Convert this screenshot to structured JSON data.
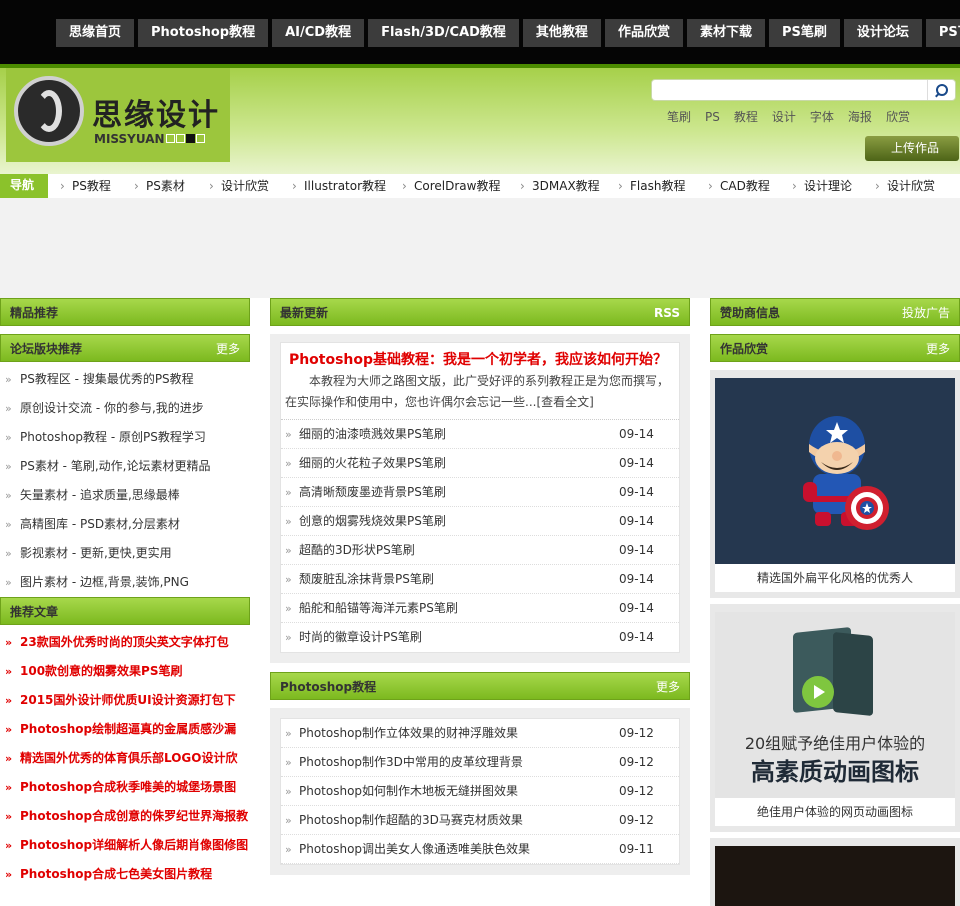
{
  "topnav": [
    "思缘首页",
    "Photoshop教程",
    "AI/CD教程",
    "Flash/3D/CAD教程",
    "其他教程",
    "作品欣赏",
    "素材下载",
    "PS笔刷",
    "设计论坛",
    "PS下载"
  ],
  "logo": {
    "cn": "思缘设计",
    "en": "MISSYUAN"
  },
  "search": {
    "placeholder": "",
    "icon": "search-icon"
  },
  "hotwords": [
    "笔刷",
    "PS",
    "教程",
    "设计",
    "字体",
    "海报",
    "欣赏"
  ],
  "upload_label": "上传作品",
  "catnav": {
    "label": "导航",
    "items": [
      "PS教程",
      "PS素材",
      "设计欣赏",
      "Illustrator教程",
      "CorelDraw教程",
      "3DMAX教程",
      "Flash教程",
      "CAD教程",
      "设计理论",
      "设计欣赏"
    ]
  },
  "left": {
    "recommend_title": "精品推荐",
    "forum_title": "论坛版块推荐",
    "forum_more": "更多",
    "forum_items": [
      "PS教程区 - 搜集最优秀的PS教程",
      "原创设计交流 - 你的参与,我的进步",
      "Photoshop教程 - 原创PS教程学习",
      "PS素材 - 笔刷,动作,论坛素材更精品",
      "矢量素材 - 追求质量,思缘最棒",
      "高精图库 - PSD素材,分层素材",
      "影视素材 - 更新,更快,更实用",
      "图片素材 - 边框,背景,装饰,PNG"
    ],
    "articles_title": "推荐文章",
    "articles": [
      "23款国外优秀时尚的顶尖英文字体打包",
      "100款创意的烟雾效果PS笔刷",
      "2015国外设计师优质UI设计资源打包下",
      "Photoshop绘制超逼真的金属质感沙漏",
      "精选国外优秀的体育俱乐部LOGO设计欣",
      "Photoshop合成秋季唯美的城堡场景图",
      "Photoshop合成创意的侏罗纪世界海报教",
      "Photoshop详细解析人像后期肖像图修图",
      "Photoshop合成七色美女图片教程"
    ]
  },
  "middle": {
    "latest_title": "最新更新",
    "latest_rss": "RSS",
    "featured_title": "Photoshop基础教程：我是一个初学者，我应该如何开始？",
    "featured_desc": "本教程为大师之路图文版，此广受好评的系列教程正是为您而撰写，在实际操作和使用中，您也许偶尔会忘记一些...[查看全文]",
    "latest": [
      {
        "title": "细丽的油漆喷溅效果PS笔刷",
        "date": "09-14"
      },
      {
        "title": "细丽的火花粒子效果PS笔刷",
        "date": "09-14"
      },
      {
        "title": "高清晰颓废墨迹背景PS笔刷",
        "date": "09-14"
      },
      {
        "title": "创意的烟雾残烧效果PS笔刷",
        "date": "09-14"
      },
      {
        "title": "超酷的3D形状PS笔刷",
        "date": "09-14"
      },
      {
        "title": "颓废脏乱涂抹背景PS笔刷",
        "date": "09-14"
      },
      {
        "title": "船舵和船锚等海洋元素PS笔刷",
        "date": "09-14"
      },
      {
        "title": "时尚的徽章设计PS笔刷",
        "date": "09-14"
      }
    ],
    "ps_title": "Photoshop教程",
    "ps_more": "更多",
    "ps": [
      {
        "title": "Photoshop制作立体效果的财神浮雕效果",
        "date": "09-12"
      },
      {
        "title": "Photoshop制作3D中常用的皮革纹理背景",
        "date": "09-12"
      },
      {
        "title": "Photoshop如何制作木地板无缝拼图效果",
        "date": "09-12"
      },
      {
        "title": "Photoshop制作超酷的3D马赛克材质效果",
        "date": "09-12"
      },
      {
        "title": "Photoshop调出美女人像通透唯美肤色效果",
        "date": "09-11"
      }
    ]
  },
  "right": {
    "sponsor_title": "赞助商信息",
    "sponsor_more": "投放广告",
    "works_title": "作品欣赏",
    "works_more": "更多",
    "works": [
      {
        "caption": "精选国外扁平化风格的优秀人"
      },
      {
        "caption": "绝佳用户体验的网页动画图标",
        "poster_line1": "20组赋予绝佳用户体验的",
        "poster_line2": "高素质动画图标"
      }
    ]
  }
}
